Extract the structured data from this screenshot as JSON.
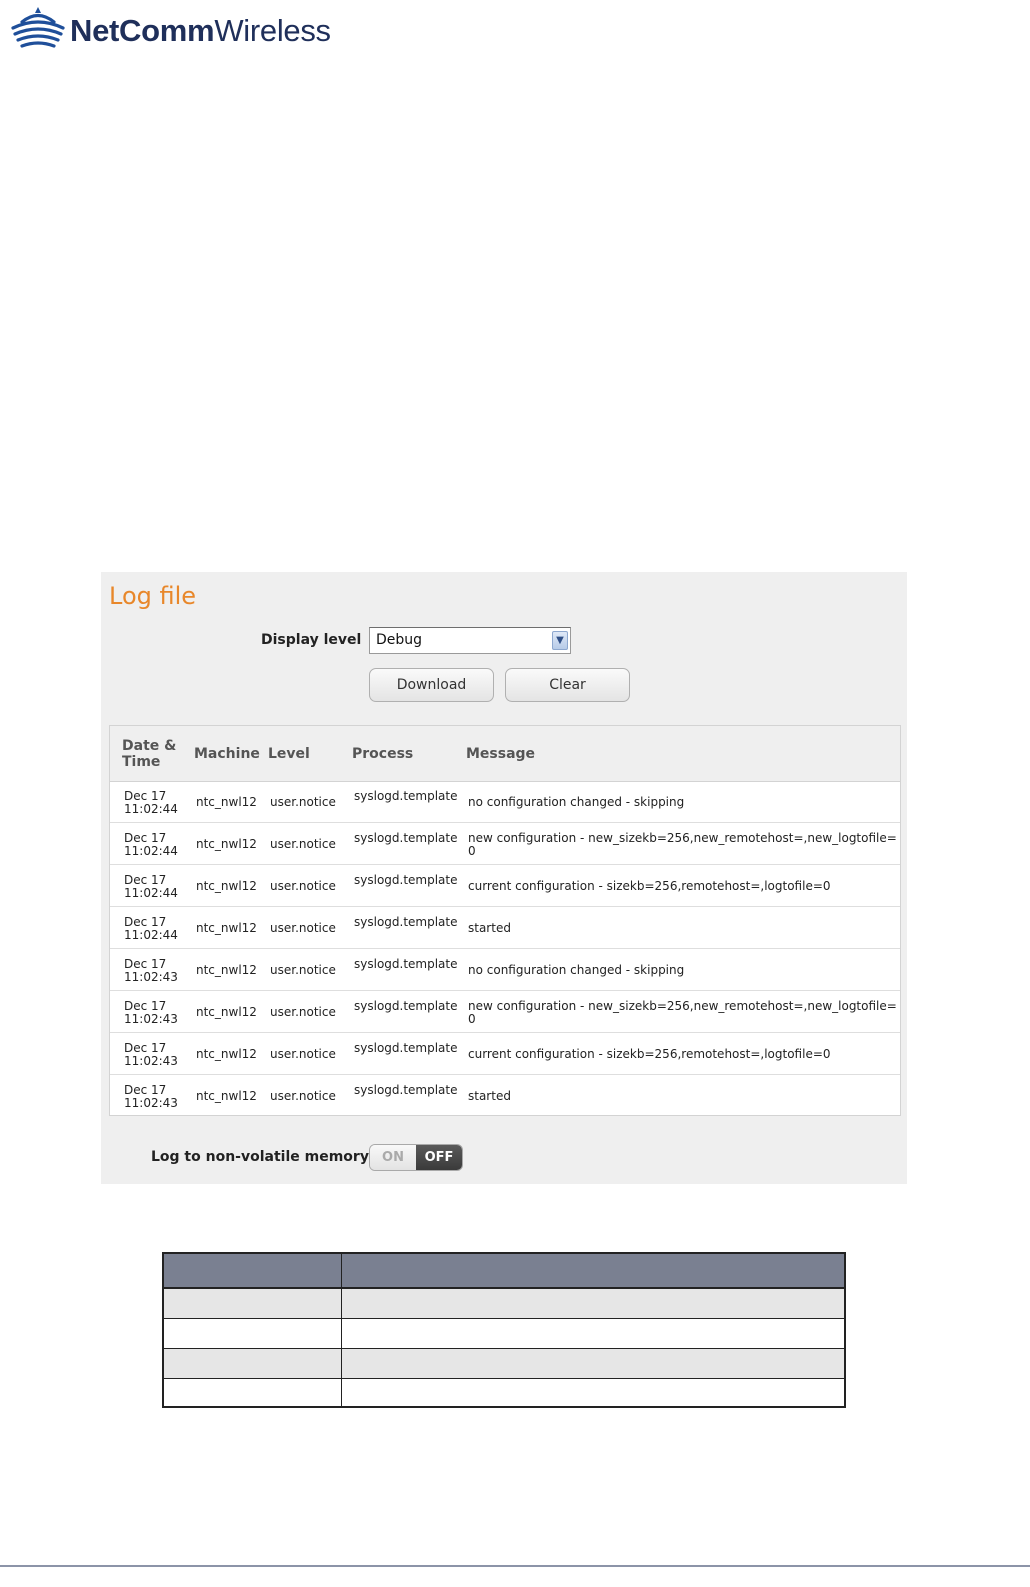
{
  "header": {
    "brand_bold": "NetComm",
    "brand_light": "Wireless",
    "logo_icon": "wifi-signal-icon",
    "brand_color": "#1f2f5a"
  },
  "log_panel": {
    "title": "Log file",
    "title_color": "#e8872a",
    "display_level_label": "Display level",
    "display_level_value": "Debug",
    "download_label": "Download",
    "clear_label": "Clear",
    "columns": [
      "Date & Time",
      "Machine",
      "Level",
      "Process",
      "Message"
    ],
    "rows": [
      {
        "date": "Dec 17",
        "time": "11:02:44",
        "machine": "ntc_nwl12",
        "level": "user.notice",
        "process": "syslogd.template",
        "message": "no configuration changed - skipping"
      },
      {
        "date": "Dec 17",
        "time": "11:02:44",
        "machine": "ntc_nwl12",
        "level": "user.notice",
        "process": "syslogd.template",
        "message": "new configuration - new_sizekb=256,new_remotehost=,new_logtofile=0"
      },
      {
        "date": "Dec 17",
        "time": "11:02:44",
        "machine": "ntc_nwl12",
        "level": "user.notice",
        "process": "syslogd.template",
        "message": "current configuration - sizekb=256,remotehost=,logtofile=0"
      },
      {
        "date": "Dec 17",
        "time": "11:02:44",
        "machine": "ntc_nwl12",
        "level": "user.notice",
        "process": "syslogd.template",
        "message": "started"
      },
      {
        "date": "Dec 17",
        "time": "11:02:43",
        "machine": "ntc_nwl12",
        "level": "user.notice",
        "process": "syslogd.template",
        "message": "no configuration changed - skipping"
      },
      {
        "date": "Dec 17",
        "time": "11:02:43",
        "machine": "ntc_nwl12",
        "level": "user.notice",
        "process": "syslogd.template",
        "message": "new configuration - new_sizekb=256,new_remotehost=,new_logtofile=0"
      },
      {
        "date": "Dec 17",
        "time": "11:02:43",
        "machine": "ntc_nwl12",
        "level": "user.notice",
        "process": "syslogd.template",
        "message": "current configuration - sizekb=256,remotehost=,logtofile=0"
      },
      {
        "date": "Dec 17",
        "time": "11:02:43",
        "machine": "ntc_nwl12",
        "level": "user.notice",
        "process": "syslogd.template",
        "message": "started"
      }
    ],
    "nonvolatile_label": "Log to non-volatile memory",
    "toggle_on_label": "ON",
    "toggle_off_label": "OFF",
    "toggle_state": "OFF"
  },
  "doc_table": {
    "header_color": "#7a8091",
    "stripe_color": "#e6e6e6"
  }
}
